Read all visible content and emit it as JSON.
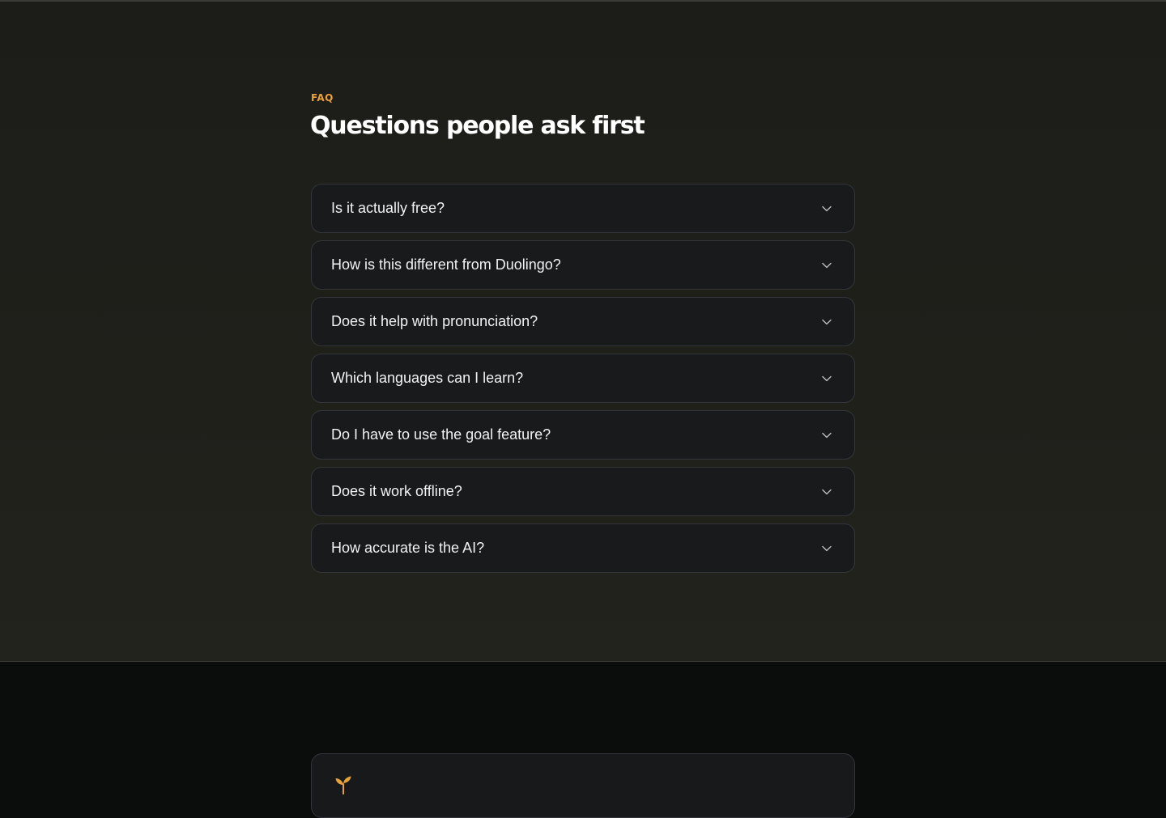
{
  "faq": {
    "eyebrow": "FAQ",
    "title": "Questions people ask first",
    "items": [
      {
        "question": "Is it actually free?"
      },
      {
        "question": "How is this different from Duolingo?"
      },
      {
        "question": "Does it help with pronunciation?"
      },
      {
        "question": "Which languages can I learn?"
      },
      {
        "question": "Do I have to use the goal feature?"
      },
      {
        "question": "Does it work offline?"
      },
      {
        "question": "How accurate is the AI?"
      }
    ]
  },
  "colors": {
    "accent": "#e8a23a",
    "section_bg": "#21211c",
    "card_bg": "#191a1c",
    "footer_bg": "#0b0d0d"
  },
  "icons": {
    "expand": "chevron-down-icon",
    "brand": "sprout-icon"
  }
}
